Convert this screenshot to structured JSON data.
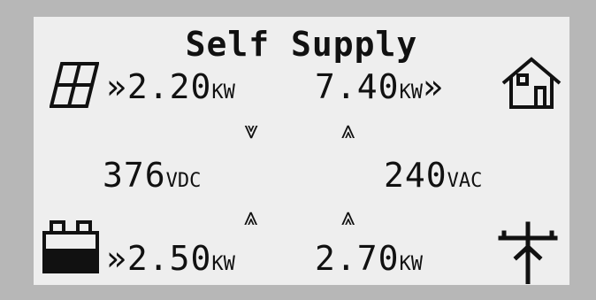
{
  "display": {
    "title": "Self Supply",
    "solar": {
      "prefix": "»",
      "value": "2.20",
      "unit": "KW"
    },
    "home": {
      "value": "7.40",
      "unit": "KW",
      "suffix": "»"
    },
    "dc_voltage": {
      "value": "376",
      "unit": "VDC"
    },
    "ac_voltage": {
      "value": "240",
      "unit": "VAC"
    },
    "battery": {
      "prefix": "»",
      "value": "2.50",
      "unit": "KW"
    },
    "grid": {
      "value": "2.70",
      "unit": "KW"
    },
    "arrows": {
      "solar_flow": "⩔",
      "home_flow": "⩓",
      "battery_flow": "⩓",
      "grid_flow": "⩓"
    },
    "icons": {
      "solar": "solar-panel-icon",
      "home": "house-icon",
      "battery": "battery-icon",
      "grid": "utility-pole-icon"
    },
    "colors": {
      "lcd_background": "#eeeeee",
      "bezel": "#b7b7b7",
      "ink": "#111111"
    }
  }
}
